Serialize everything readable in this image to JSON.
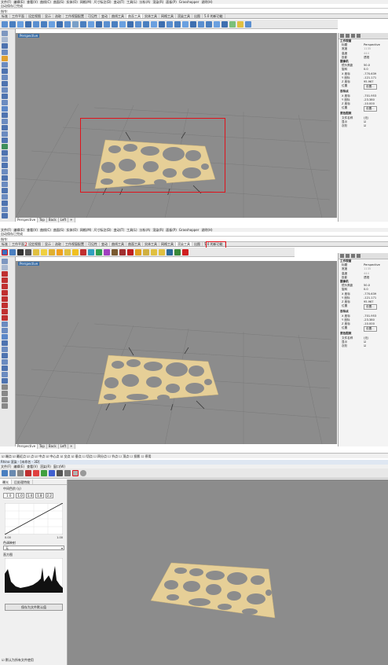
{
  "panel1": {
    "menu": [
      "文件(F)",
      "编辑(E)",
      "查看(V)",
      "曲线(C)",
      "曲面(S)",
      "实体(O)",
      "网格(M)",
      "尺寸标注(D)",
      "变动(T)",
      "工具(L)",
      "分析(A)",
      "渲染(R)",
      "面板(P)",
      "Grasshopper",
      "说明(H)"
    ],
    "status_text": "自动保存已完成",
    "command_label": "指令:",
    "tabs": [
      "标准",
      "工作平面",
      "设定视图",
      "显示",
      "选取",
      "工作视窗配置",
      "可见性",
      "变动",
      "曲线工具",
      "曲面工具",
      "实体工具",
      "网格工具",
      "渲染工具",
      "出图",
      "5.0 的新功能"
    ],
    "active_tab": "曲面工具",
    "viewport_label": "Perspective",
    "view_tabs": [
      "Perspective",
      "Top",
      "Back",
      "Left",
      "+"
    ],
    "props": {
      "section_viewport": "工作视窗",
      "title_key": "标题",
      "title_val": "Perspective",
      "width_key": "宽度",
      "width_val": "1135",
      "height_key": "高度",
      "height_val": "444",
      "projection_key": "投影",
      "projection_val": "透视",
      "section_camera": "摄像机",
      "lens_key": "镜头焦距",
      "lens_val": "50.0",
      "rotation_key": "旋转",
      "rotation_val": "0.0",
      "x_key": "X 座标",
      "x_val": "-770.639",
      "y_key": "Y 座标",
      "y_val": "-121.171",
      "z_key": "Z 座标",
      "z_val": "95.967",
      "pos_key": "位置",
      "pos_btn": "设置...",
      "section_target": "目标点",
      "tx_val": "-701.953",
      "ty_val": "-23.380",
      "tz_val": "-10.000",
      "section_wallpaper": "底色图案",
      "filename_key": "文件名称",
      "filename_val": "(无)",
      "show_key": "显示",
      "gray_key": "灰阶"
    }
  },
  "panel2": {
    "menu": [
      "文件(F)",
      "编辑(E)",
      "查看(V)",
      "曲线(C)",
      "曲面(S)",
      "实体(O)",
      "网格(M)",
      "尺寸标注(D)",
      "变动(T)",
      "工具(L)",
      "分析(A)",
      "渲染(R)",
      "面板(P)",
      "Grasshopper",
      "说明(H)"
    ],
    "status_text": "自动保存已完成",
    "command_label": "指令:",
    "tabs": [
      "标准",
      "工作平面",
      "设定视图",
      "显示",
      "选取",
      "工作视窗配置",
      "可见性",
      "变动",
      "曲线工具",
      "曲面工具",
      "实体工具",
      "网格工具",
      "渲染工具",
      "出图",
      "5.0 的新功能"
    ],
    "active_tab": "渲染工具",
    "annotation_1": "1",
    "annotation_2": "2",
    "viewport_label": "Perspective",
    "view_tabs": [
      "Perspective",
      "Top",
      "Back",
      "Left",
      "+"
    ],
    "snaps": [
      "端点",
      "最近点",
      "点",
      "中点",
      "中心点",
      "交点",
      "垂点",
      "切点",
      "四分点",
      "节点",
      "顶点",
      "投影",
      "停用"
    ]
  },
  "panel3": {
    "title": "Rhino 渲染 - [未命名 - 3D]",
    "menu": [
      "文件(F)",
      "编辑(E)",
      "查看(V)",
      "渲染(R)",
      "窗口(W)"
    ],
    "left_tabs": [
      "曝光",
      "后处理特效"
    ],
    "midtone_label": "中间色阶 (γ)",
    "gamma_val": "1.0",
    "preset_buttons": [
      "1.0",
      "1.4",
      "1.8",
      "2.2"
    ],
    "tone_min": "0.00",
    "tone_max": "1.00",
    "curve_label": "色调映射",
    "curve_select": "无",
    "histogram_label": "直方图",
    "save_default_btn": "保存为文件默认值",
    "bottom_check": "默认为所有文件使用"
  },
  "colors": {
    "viewport": "#8c8c8c",
    "panel_model": "#e6cf97",
    "selection_red": "#e0121b",
    "vp_label_bg": "#3b6ea5"
  }
}
